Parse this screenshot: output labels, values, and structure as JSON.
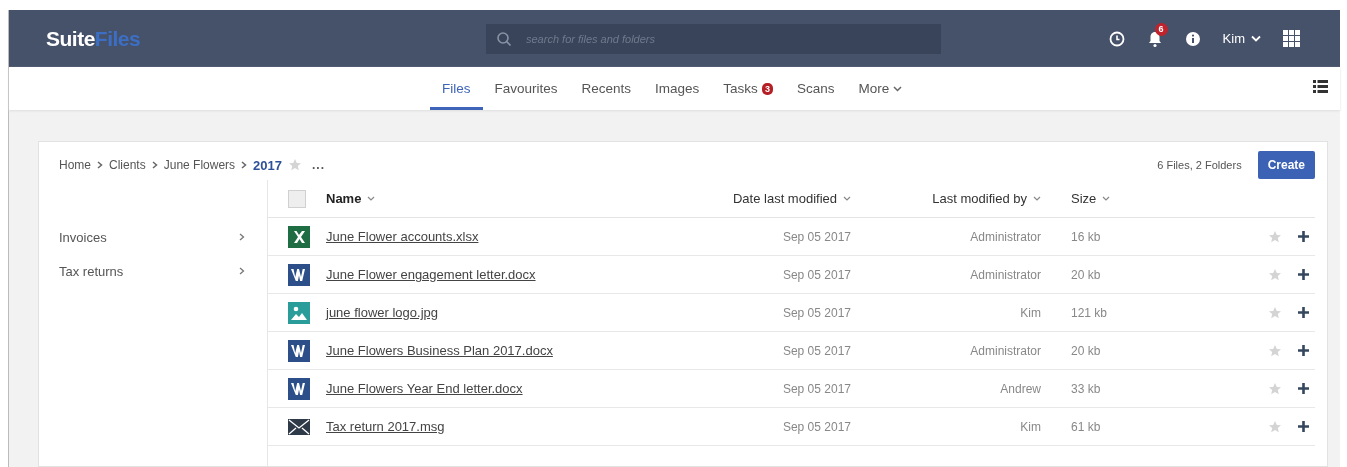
{
  "header": {
    "logo": {
      "first": "Suite",
      "second": "Files"
    },
    "search": {
      "placeholder": "search for files and folders"
    },
    "notifications": {
      "count": "6"
    },
    "user": {
      "name": "Kim"
    }
  },
  "tabs": [
    {
      "label": "Files",
      "selected": true
    },
    {
      "label": "Favourites",
      "selected": false
    },
    {
      "label": "Recents",
      "selected": false
    },
    {
      "label": "Images",
      "selected": false
    },
    {
      "label": "Tasks",
      "selected": false,
      "badge": "3"
    },
    {
      "label": "Scans",
      "selected": false
    },
    {
      "label": "More",
      "selected": false,
      "dropdown": true
    }
  ],
  "breadcrumb": {
    "items": [
      "Home",
      "Clients",
      "June Flowers"
    ],
    "current": "2017",
    "starred": false,
    "more": "..."
  },
  "summary": "6 Files, 2 Folders",
  "create_button": "Create",
  "sidebar": {
    "items": [
      "Invoices",
      "Tax returns"
    ]
  },
  "table": {
    "columns": [
      "Name",
      "Date last modified",
      "Last modified by",
      "Size"
    ],
    "select_all": {
      "checked": false
    },
    "rows": [
      {
        "kind": "excel",
        "name": "June Flower accounts.xlsx",
        "date": "Sep 05 2017",
        "by": "Administrator",
        "size": "16 kb",
        "starred": false
      },
      {
        "kind": "word",
        "name": "June Flower engagement letter.docx",
        "date": "Sep 05 2017",
        "by": "Administrator",
        "size": "20 kb",
        "starred": false
      },
      {
        "kind": "image",
        "name": "june flower logo.jpg",
        "date": "Sep 05 2017",
        "by": "Kim",
        "size": "121 kb",
        "starred": false
      },
      {
        "kind": "word",
        "name": "June Flowers Business Plan 2017.docx",
        "date": "Sep 05 2017",
        "by": "Administrator",
        "size": "20 kb",
        "starred": false
      },
      {
        "kind": "word",
        "name": "June Flowers Year End letter.docx",
        "date": "Sep 05 2017",
        "by": "Andrew",
        "size": "33 kb",
        "starred": false
      },
      {
        "kind": "email",
        "name": "Tax return 2017.msg",
        "date": "Sep 05 2017",
        "by": "Kim",
        "size": "61 kb",
        "starred": false
      }
    ]
  }
}
